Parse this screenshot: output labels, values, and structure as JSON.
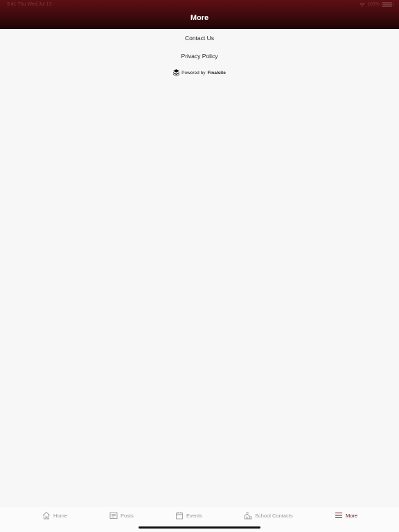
{
  "status_bar": {
    "time": "9:41 Thu Wed Jul 13",
    "battery": "100%"
  },
  "header": {
    "title": "More"
  },
  "menu": {
    "items": [
      {
        "label": "Contact Us"
      },
      {
        "label": "Privacy Policy"
      }
    ]
  },
  "footer": {
    "powered_prefix": "Powered by",
    "powered_brand": "Finalsite"
  },
  "tabbar": {
    "tabs": [
      {
        "label": "Home",
        "icon": "home-icon"
      },
      {
        "label": "Posts",
        "icon": "posts-icon"
      },
      {
        "label": "Events",
        "icon": "calendar-icon"
      },
      {
        "label": "School Contacts",
        "icon": "school-icon"
      },
      {
        "label": "More",
        "icon": "menu-icon",
        "active": true
      }
    ]
  },
  "colors": {
    "header": "#5e0f14",
    "active_tab": "#6b1219",
    "inactive_tab": "#9a9a9a"
  }
}
